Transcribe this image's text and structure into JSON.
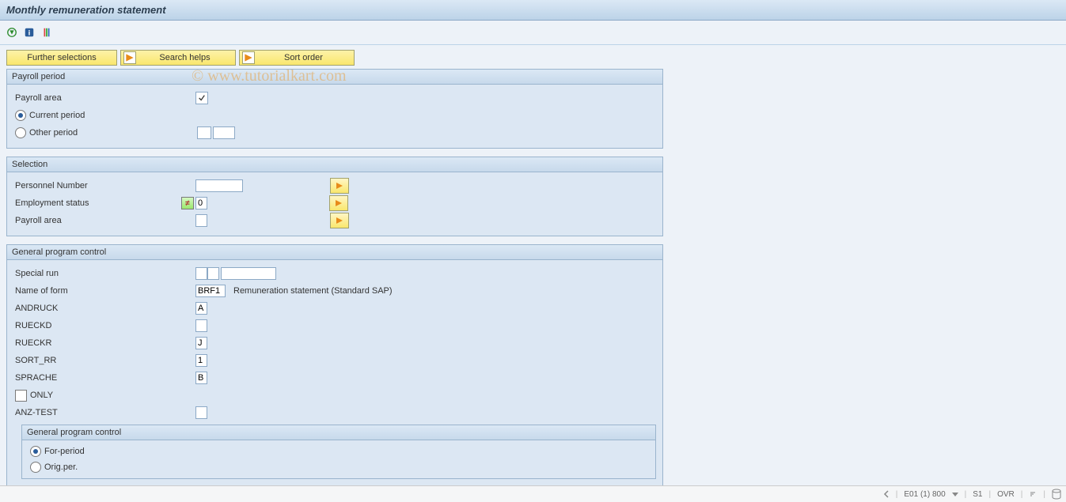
{
  "title": "Monthly remuneration statement",
  "watermark": "© www.tutorialkart.com",
  "top_buttons": {
    "further": "Further selections",
    "search": "Search helps",
    "sort": "Sort order"
  },
  "payroll_period": {
    "title": "Payroll period",
    "area_label": "Payroll area",
    "current": "Current period",
    "other": "Other period"
  },
  "selection": {
    "title": "Selection",
    "personnel": "Personnel Number",
    "employment": "Employment status",
    "employment_value": "0",
    "area": "Payroll area"
  },
  "general": {
    "title": "General program control",
    "special": "Special run",
    "form_label": "Name of form",
    "form_value": "BRF1",
    "form_desc": "Remuneration statement (Standard SAP)",
    "andruck_label": "ANDRUCK",
    "andruck_value": "A",
    "rueckd_label": "RUECKD",
    "rueckr_label": "RUECKR",
    "rueckr_value": "J",
    "sortrr_label": "SORT_RR",
    "sortrr_value": "1",
    "sprache_label": "SPRACHE",
    "sprache_value": "B",
    "only": "ONLY",
    "anztest": "ANZ-TEST",
    "inner_title": "General program control",
    "forperiod": "For-period",
    "origper": "Orig.per."
  },
  "status": {
    "sys": "E01 (1) 800",
    "srv": "S1",
    "mode": "OVR"
  }
}
